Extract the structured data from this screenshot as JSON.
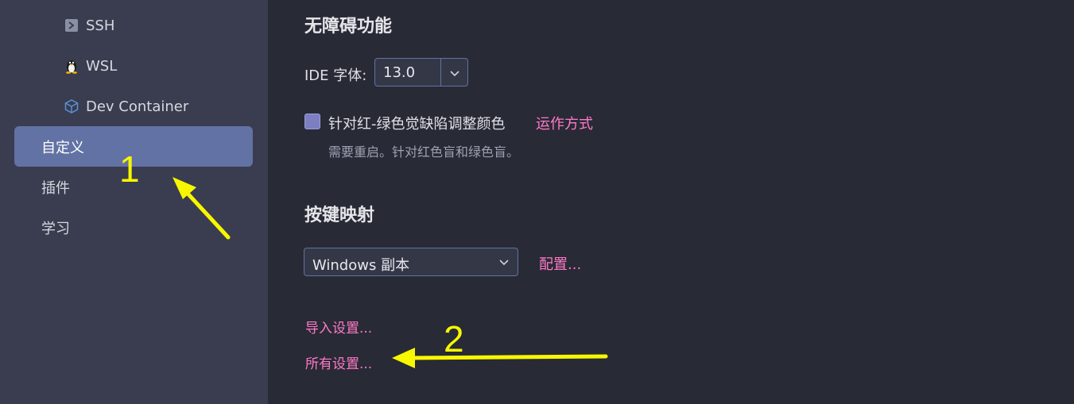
{
  "sidebar": {
    "sub_items": [
      {
        "label": "SSH",
        "icon": "terminal-icon"
      },
      {
        "label": "WSL",
        "icon": "linux-penguin-icon"
      },
      {
        "label": "Dev Container",
        "icon": "cube-icon"
      }
    ],
    "items": [
      {
        "label": "自定义",
        "active": true
      },
      {
        "label": "插件",
        "active": false
      },
      {
        "label": "学习",
        "active": false
      }
    ]
  },
  "accessibility": {
    "title": "无障碍功能",
    "ide_font_label": "IDE 字体:",
    "ide_font_value": "13.0",
    "colorblind_checkbox_label": "针对红-绿色觉缺陷调整颜色",
    "colorblind_link": "运作方式",
    "colorblind_hint": "需要重启。针对红色盲和绿色盲。"
  },
  "keymap": {
    "title": "按键映射",
    "selected": "Windows 副本",
    "configure_link": "配置..."
  },
  "links": {
    "import_settings": "导入设置...",
    "all_settings": "所有设置..."
  },
  "annotations": {
    "step1": "1",
    "step2": "2",
    "color": "#f7f700"
  },
  "colors": {
    "accent_link": "#ff79c6",
    "selection": "#6272a4"
  }
}
